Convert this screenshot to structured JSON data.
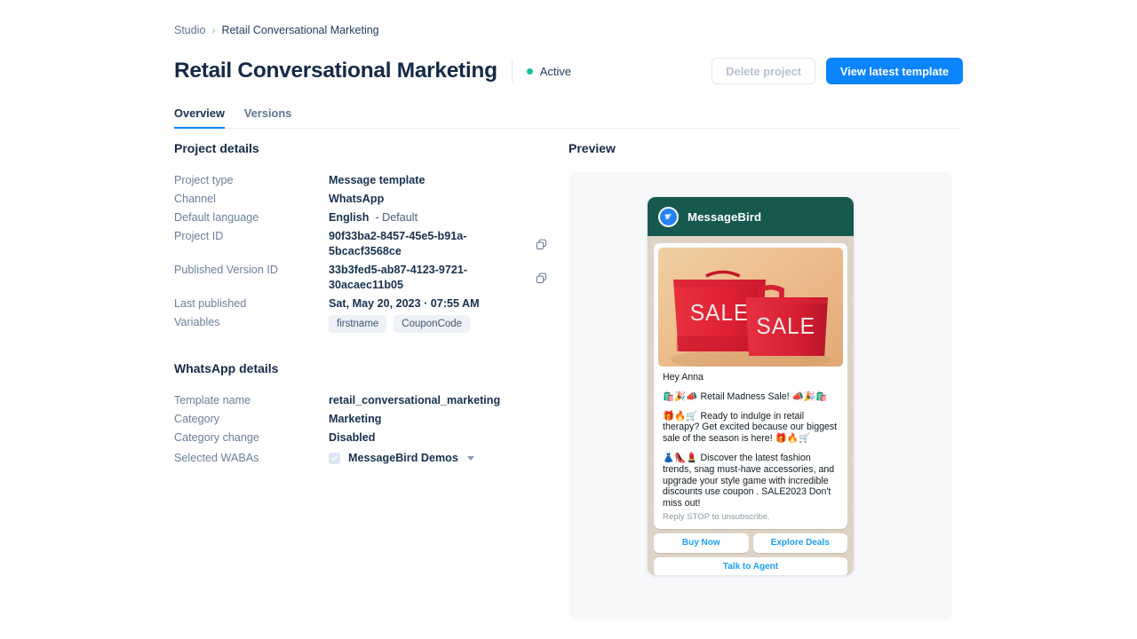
{
  "breadcrumb": {
    "root": "Studio",
    "separator": "›",
    "current": "Retail Conversational Marketing"
  },
  "header": {
    "title": "Retail Conversational Marketing",
    "status_label": "Active",
    "status_color": "#18c29c",
    "delete_button": "Delete project",
    "view_button": "View latest template",
    "primary_color": "#0a84ff"
  },
  "tabs": [
    {
      "label": "Overview",
      "active": true
    },
    {
      "label": "Versions",
      "active": false
    }
  ],
  "project_details": {
    "section_title": "Project details",
    "rows": [
      {
        "label": "Project type",
        "value": "Message template"
      },
      {
        "label": "Channel",
        "value": "WhatsApp"
      },
      {
        "label": "Default language",
        "value": "English",
        "suffix": "- Default"
      },
      {
        "label": "Project ID",
        "value": "90f33ba2-8457-45e5-b91a-5bcacf3568ce",
        "copy": true
      },
      {
        "label": "Published Version ID",
        "value": "33b3fed5-ab87-4123-9721-30acaec11b05",
        "copy": true
      },
      {
        "label": "Last published",
        "value": "Sat, May 20, 2023  ·  07:55 AM"
      },
      {
        "label": "Variables",
        "chips": [
          "firstname",
          "CouponCode"
        ]
      }
    ]
  },
  "whatsapp_details": {
    "section_title": "WhatsApp details",
    "rows": [
      {
        "label": "Template name",
        "value": "retail_conversational_marketing"
      },
      {
        "label": "Category",
        "value": "Marketing"
      },
      {
        "label": "Category change",
        "value": "Disabled"
      },
      {
        "label": "Selected WABAs",
        "value": "MessageBird Demos",
        "checkbox": true,
        "dropdown": true
      }
    ]
  },
  "preview": {
    "section_title": "Preview",
    "channel_name": "MessageBird",
    "header_color": "#17594f",
    "image_alt": "Two red SALE shopping bags on a tan background",
    "image_text": "SALE",
    "greeting": "Hey Anna",
    "paragraphs": [
      "🛍️🎉📣 Retail Madness Sale! 📣🎉🛍️",
      "🎁🔥🛒 Ready to indulge in retail therapy? Get excited because our biggest sale of the season is here! 🎁🔥🛒",
      "👗👠💄 Discover the latest fashion trends, snag must-have accessories, and upgrade your style game with incredible discounts use coupon . SALE2023 Don't miss out!"
    ],
    "footer": "Reply STOP to unsubscribe.",
    "buttons": [
      "Buy Now",
      "Explore Deals",
      "Talk to Agent"
    ]
  }
}
